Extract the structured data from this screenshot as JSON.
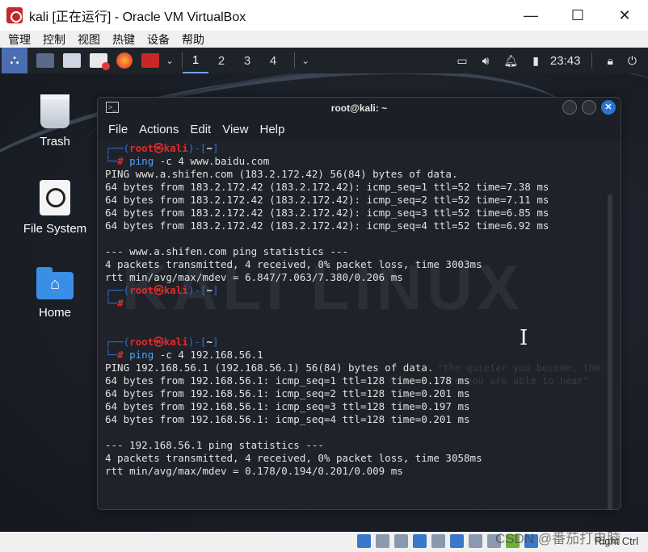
{
  "window": {
    "title": "kali [正在运行] - Oracle VM VirtualBox",
    "minimize": "—",
    "maximize": "☐",
    "close": "✕"
  },
  "host_menu": [
    "管理",
    "控制",
    "视图",
    "热键",
    "设备",
    "帮助"
  ],
  "panel": {
    "workspaces": [
      "1",
      "2",
      "3",
      "4"
    ],
    "active_workspace": "1",
    "time": "23:43",
    "chevron": "⌄",
    "tray_icons": [
      "monitor-icon",
      "volume-icon",
      "bell-icon",
      "battery-icon",
      "lock-icon",
      "power-icon"
    ]
  },
  "desktop_icons": [
    {
      "label": "Trash",
      "icon": "trash-icon"
    },
    {
      "label": "File System",
      "icon": "drive-icon"
    },
    {
      "label": "Home",
      "icon": "home-folder-icon"
    }
  ],
  "terminal": {
    "title": "root@kali: ~",
    "menu": [
      "File",
      "Actions",
      "Edit",
      "View",
      "Help"
    ],
    "watermark": "KALI LINUX",
    "watermark_sub": "\"the quieter you become, the more you are able to hear\"",
    "prompt": {
      "corner_top": "┌──",
      "open": "(",
      "user": "root",
      "at": "㉿",
      "host": "kali",
      "close": ")",
      "dash": "-",
      "dir_open": "[",
      "dir": "~",
      "dir_close": "]",
      "corner_bottom": "└─",
      "hash": "#"
    },
    "blocks": [
      {
        "command": "ping",
        "args": "-c 4 www.baidu.com",
        "output": [
          "PING www.a.shifen.com (183.2.172.42) 56(84) bytes of data.",
          "64 bytes from 183.2.172.42 (183.2.172.42): icmp_seq=1 ttl=52 time=7.38 ms",
          "64 bytes from 183.2.172.42 (183.2.172.42): icmp_seq=2 ttl=52 time=7.11 ms",
          "64 bytes from 183.2.172.42 (183.2.172.42): icmp_seq=3 ttl=52 time=6.85 ms",
          "64 bytes from 183.2.172.42 (183.2.172.42): icmp_seq=4 ttl=52 time=6.92 ms",
          "",
          "--- www.a.shifen.com ping statistics ---",
          "4 packets transmitted, 4 received, 0% packet loss, time 3003ms",
          "rtt min/avg/max/mdev = 6.847/7.063/7.380/0.206 ms"
        ]
      },
      {
        "command": "",
        "args": "",
        "output": []
      },
      {
        "command": "ping",
        "args": "-c 4 192.168.56.1",
        "output": [
          "PING 192.168.56.1 (192.168.56.1) 56(84) bytes of data.",
          "64 bytes from 192.168.56.1: icmp_seq=1 ttl=128 time=0.178 ms",
          "64 bytes from 192.168.56.1: icmp_seq=2 ttl=128 time=0.201 ms",
          "64 bytes from 192.168.56.1: icmp_seq=3 ttl=128 time=0.197 ms",
          "64 bytes from 192.168.56.1: icmp_seq=4 ttl=128 time=0.201 ms",
          "",
          "--- 192.168.56.1 ping statistics ---",
          "4 packets transmitted, 4 received, 0% packet loss, time 3058ms",
          "rtt min/avg/max/mdev = 0.178/0.194/0.201/0.009 ms"
        ]
      }
    ]
  },
  "statusbar": {
    "host_key": "Right Ctrl",
    "watermark": "CSDN @番茄打电脑"
  },
  "colors": {
    "prompt_frame": "#2f6fd6",
    "prompt_user": "#e02b2b",
    "command": "#4fa3ff",
    "terminal_bg": "#1f2229",
    "panel_bg": "#1e2229"
  }
}
